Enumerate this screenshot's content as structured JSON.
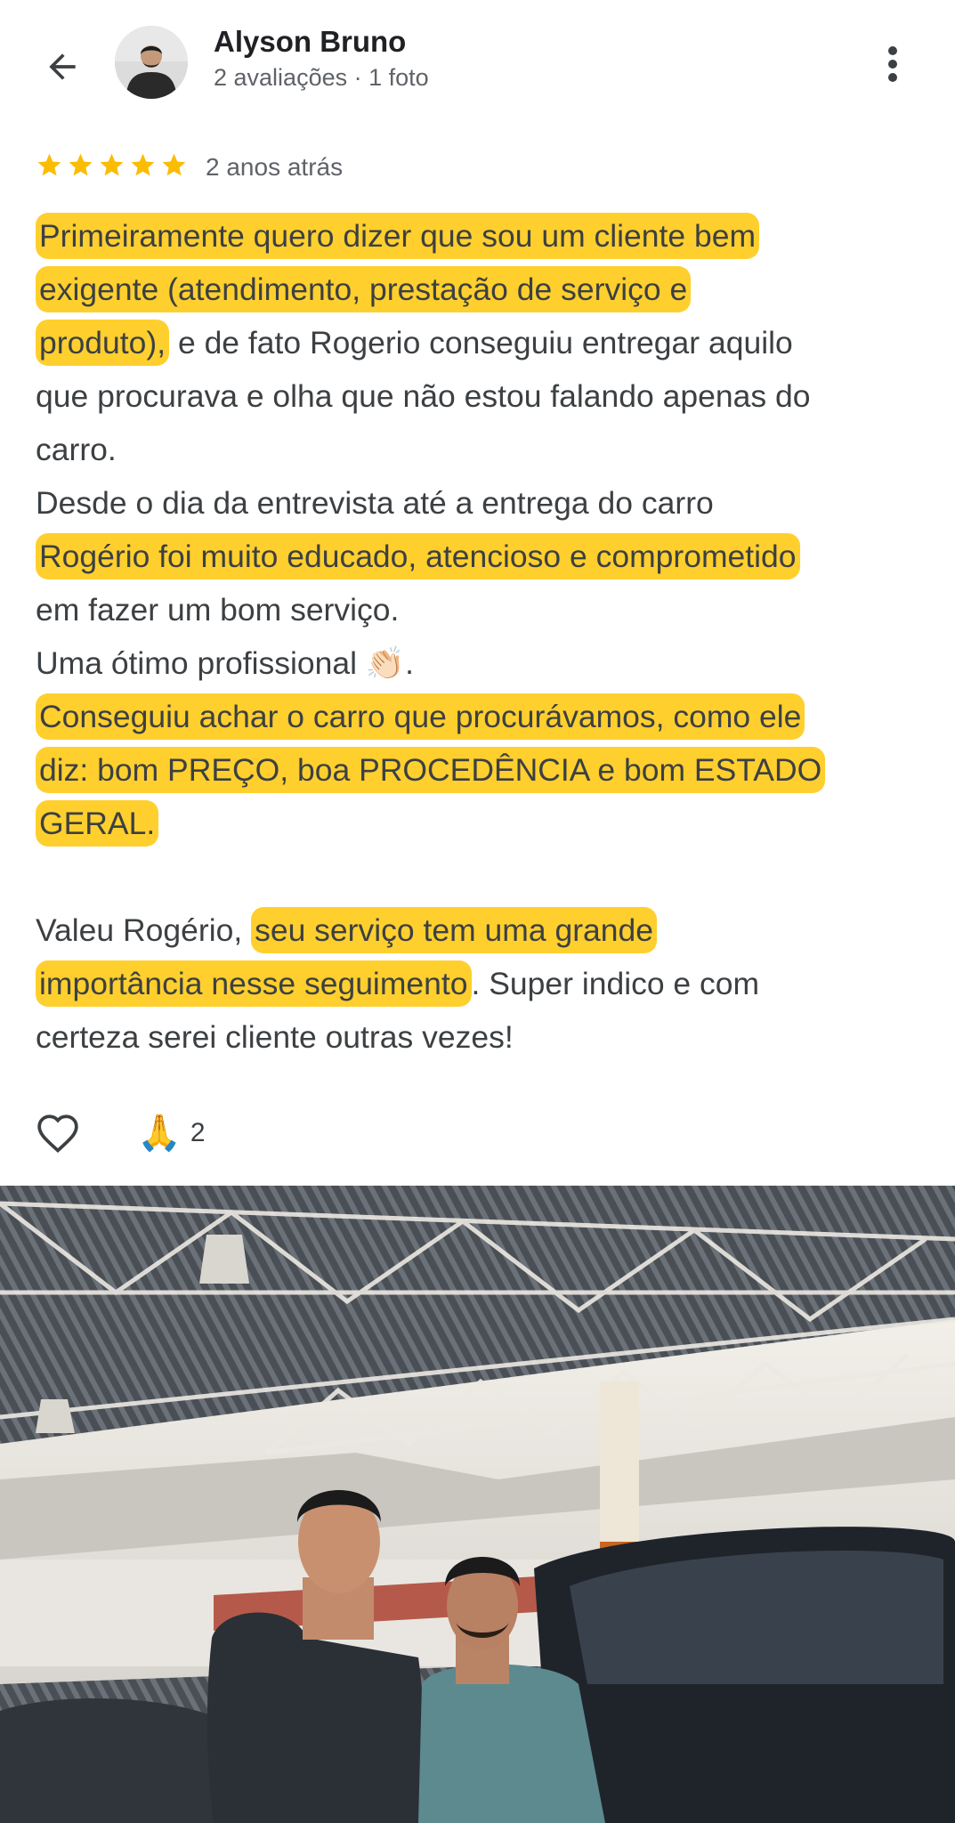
{
  "header": {
    "author_name": "Alyson Bruno",
    "author_meta": "2 avaliações · 1 foto"
  },
  "review": {
    "rating": 5,
    "rating_max": 5,
    "date": "2 anos atrás",
    "lines": {
      "l1": "Primeiramente quero dizer que sou um cliente bem",
      "l2": "exigente (atendimento, prestação de serviço e",
      "l3a": "produto),",
      "l3b": " e de fato Rogerio conseguiu entregar aquilo",
      "l4": "que procurava e olha que não estou falando apenas do",
      "l5": "carro.",
      "l6": "Desde o dia da entrevista até a entrega do carro",
      "l7": "Rogério foi muito educado, atencioso e comprometido",
      "l8": "em fazer um bom serviço.",
      "l9a": "Uma ótimo profissional ",
      "l9_emoji": "👏🏻",
      "l9b": ".",
      "l10": "Conseguiu achar o carro que procurávamos, como ele",
      "l11": "diz: bom PREÇO, boa PROCEDÊNCIA e bom ESTADO",
      "l12": "GERAL.",
      "l13a": "Valeu Rogério, ",
      "l13b": "seu serviço tem uma grande",
      "l14a": "importância nesse seguimento",
      "l14b": ". Super indico e com",
      "l15": "certeza serei cliente outras vezes!"
    }
  },
  "reactions": {
    "emoji": "🙏",
    "count": "2"
  },
  "icons": {
    "back": "arrow-back-icon",
    "more": "more-vert-icon",
    "star": "star-icon",
    "like": "heart-outline-icon"
  },
  "colors": {
    "star": "#FBBC04",
    "highlight": "#FFC500",
    "text": "#3C4043",
    "secondary": "#5F6368"
  }
}
